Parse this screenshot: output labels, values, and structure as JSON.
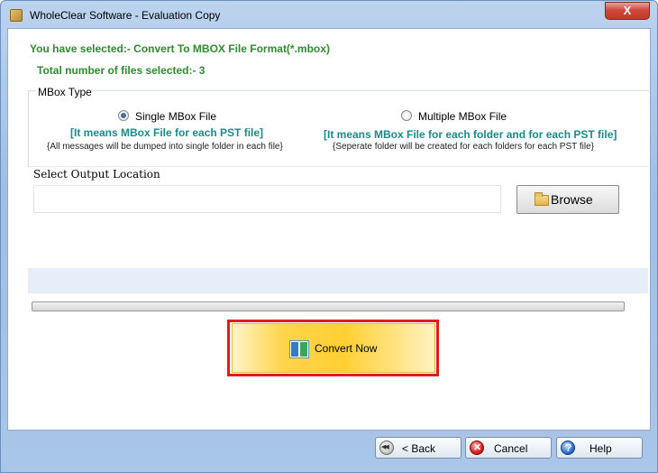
{
  "window": {
    "title": "WholeClear Software - Evaluation Copy",
    "close_glyph": "X"
  },
  "info": {
    "selected_format": "You have selected:- Convert To MBOX File Format(*.mbox)",
    "file_count": "Total number of files selected:- 3"
  },
  "mbox_type": {
    "legend": "MBox Type",
    "options": [
      {
        "label": "Single MBox File",
        "checked": true,
        "meaning": "[It means MBox File for each PST file]",
        "note": "{All messages will be dumped into single folder in each file}"
      },
      {
        "label": "Multiple MBox File",
        "checked": false,
        "meaning": "[It means MBox File for each folder and for each PST file]",
        "note": "{Seperate folder will be created for each folders for each PST file}"
      }
    ]
  },
  "output": {
    "label": "Select Output Location",
    "value": "",
    "browse_label": "Browse"
  },
  "progress": {
    "value": 0
  },
  "convert": {
    "label": "Convert Now"
  },
  "footer": {
    "back_label": "< Back",
    "cancel_label": "Cancel",
    "help_label": "Help"
  },
  "icons": {
    "app": "app-icon",
    "folder": "folder-icon",
    "convert": "convert-icon",
    "back": "back-icon",
    "cancel": "cancel-icon",
    "help": "help-icon"
  },
  "colors": {
    "info_text": "#2e8b2e",
    "meaning_text": "#1a8a8a",
    "highlight_border": "#e01c1c",
    "convert_fill": "#ffcf33"
  }
}
